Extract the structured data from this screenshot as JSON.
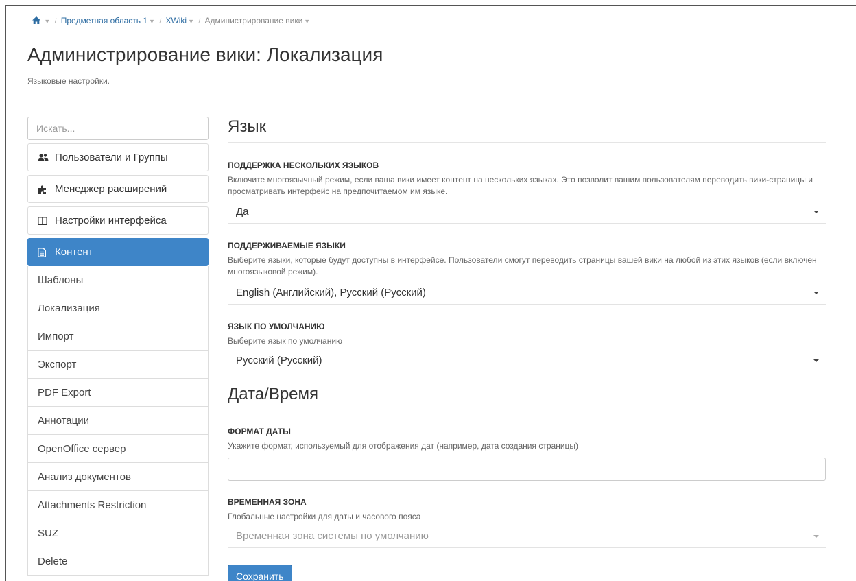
{
  "breadcrumb": {
    "items": [
      "Предметная область 1",
      "XWiki",
      "Администрирование вики"
    ]
  },
  "page": {
    "title": "Администрирование вики: Локализация",
    "hint": "Языковые настройки."
  },
  "sidebar": {
    "search_placeholder": "Искать...",
    "categories": [
      {
        "label": "Пользователи и Группы",
        "icon": "users-icon"
      },
      {
        "label": "Менеджер расширений",
        "icon": "puzzle-icon"
      },
      {
        "label": "Настройки интерфейса",
        "icon": "columns-icon"
      },
      {
        "label": "Контент",
        "icon": "document-icon",
        "active": true
      }
    ],
    "subitems": [
      "Шаблоны",
      "Локализация",
      "Импорт",
      "Экспорт",
      "PDF Export",
      "Аннотации",
      "OpenOffice сервер",
      "Анализ документов",
      "Attachments Restriction",
      "SUZ",
      "Delete"
    ]
  },
  "language_section": {
    "title": "Язык",
    "multilingual": {
      "label": "ПОДДЕРЖКА НЕСКОЛЬКИХ ЯЗЫКОВ",
      "hint": "Включите многоязычный режим, если ваша вики имеет контент на нескольких языках. Это позволит вашим пользователям переводить вики-страницы и просматривать интерфейс на предпочитаемом им языке.",
      "value": "Да"
    },
    "supported": {
      "label": "ПОДДЕРЖИВАЕМЫЕ ЯЗЫКИ",
      "hint": "Выберите языки, которые будут доступны в интерфейсе. Пользователи смогут переводить страницы вашей вики на любой из этих языков (если включен многоязыковой режим).",
      "value": "English (Английский), Русский (Русский)"
    },
    "default": {
      "label": "ЯЗЫК ПО УМОЛЧАНИЮ",
      "hint": "Выберите язык по умолчанию",
      "value": "Русский (Русский)"
    }
  },
  "datetime_section": {
    "title": "Дата/Время",
    "date_format": {
      "label": "ФОРМАТ ДАТЫ",
      "hint": "Укажите формат, используемый для отображения дат (например, дата создания страницы)",
      "value": ""
    },
    "timezone": {
      "label": "ВРЕМЕННАЯ ЗОНА",
      "hint": "Глобальные настройки для даты и часового пояса",
      "value": "Временная зона системы по умолчанию"
    }
  },
  "actions": {
    "save_label": "Сохранить"
  },
  "colors": {
    "accent": "#3e85c8",
    "link": "#2d6ca2"
  }
}
